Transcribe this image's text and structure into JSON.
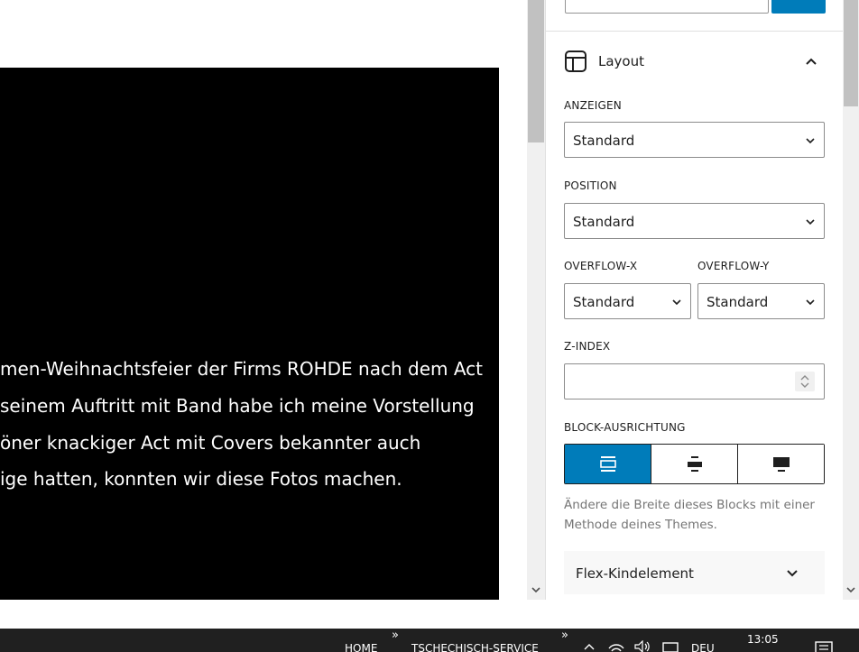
{
  "canvas": {
    "paragraph_lines": [
      "men-Weihnachtsfeier der Firms ROHDE nach dem Act",
      "seinem Auftritt mit Band habe ich meine Vorstellung",
      "öner knackiger Act mit Covers bekannter auch",
      "ige hatten, konnten wir diese Fotos machen."
    ]
  },
  "sidebar": {
    "layout_panel": {
      "title": "Layout",
      "expanded": true,
      "display": {
        "label": "ANZEIGEN",
        "value": "Standard"
      },
      "position": {
        "label": "POSITION",
        "value": "Standard"
      },
      "overflow_x": {
        "label": "OVERFLOW-X",
        "value": "Standard"
      },
      "overflow_y": {
        "label": "OVERFLOW-Y",
        "value": "Standard"
      },
      "z_index": {
        "label": "Z-INDEX",
        "value": ""
      },
      "block_alignment": {
        "label": "BLOCK-AUSRICHTUNG",
        "selected": "none",
        "options": [
          "none",
          "wide",
          "full"
        ]
      },
      "help_text": "Ändere die Breite dieses Blocks mit einer Methode deines Themes."
    },
    "flex_panel": {
      "title": "Flex-Kindelement",
      "expanded": false
    }
  },
  "taskbar": {
    "toolbar_1": "HOME",
    "toolbar_2": "TSCHECHISCH-SERVICE",
    "language": "DEU",
    "time": "13:05"
  },
  "colors": {
    "accent": "#007cba",
    "cover_background": "#000000",
    "taskbar": "#202020"
  },
  "icons": [
    "layout-icon",
    "chevron-up-icon",
    "chevron-down-icon",
    "align-none-icon",
    "align-wide-icon",
    "align-full-icon",
    "notification-icon",
    "wifi-icon",
    "volume-icon"
  ]
}
